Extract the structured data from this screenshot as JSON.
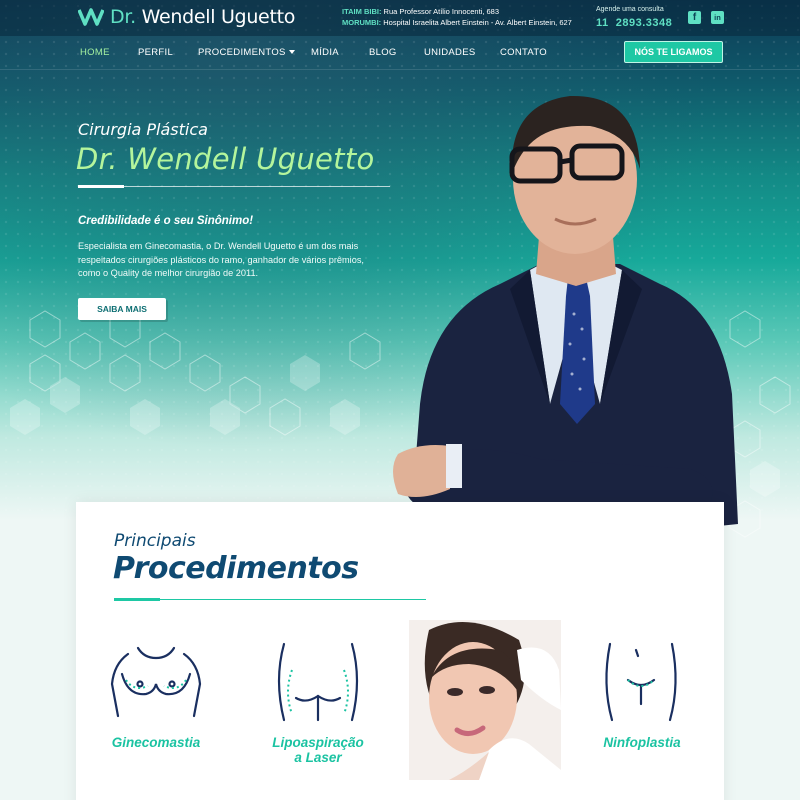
{
  "header": {
    "logo_prefix": "Dr.",
    "logo_name": "Wendell Uguetto",
    "addresses": [
      {
        "key": "ITAIM BIBI:",
        "text": "Rua Professor Atílio Innocenti, 683"
      },
      {
        "key": "MORUMBI:",
        "text": "Hospital Israelita Albert Einstein - Av. Albert Einstein, 627"
      }
    ],
    "consult_label": "Agende uma consulta",
    "phone_prefix": "11",
    "phone": "2893.3348",
    "social": [
      {
        "name": "facebook-icon",
        "glyph": "f"
      },
      {
        "name": "linkedin-icon",
        "glyph": "in"
      }
    ]
  },
  "nav": {
    "items": [
      "HOME",
      "PERFIL",
      "PROCEDIMENTOS",
      "MÍDIA",
      "BLOG",
      "UNIDADES",
      "CONTATO"
    ],
    "cta": "NÓS TE LIGAMOS"
  },
  "hero": {
    "subtitle": "Cirurgia Plástica",
    "title": "Dr. Wendell  Uguetto",
    "tagline": "Credibilidade é o seu Sinônimo!",
    "description": "Especialista em Ginecomastia, o Dr. Wendell Uguetto é um dos mais respeitados cirurgiões plásticos do ramo, ganhador de vários prêmios, como o Quality de melhor cirurgião de 2011.",
    "button": "SAIBA MAIS"
  },
  "procedures": {
    "subtitle": "Principais",
    "title": "Procedimentos",
    "items": [
      {
        "label": "Ginecomastia",
        "icon": "chest-icon"
      },
      {
        "label": "Lipoaspiração\na Laser",
        "icon": "torso-icon"
      },
      {
        "label": "",
        "icon": "face-photo"
      },
      {
        "label": "Ninfoplastia",
        "icon": "pelvis-icon"
      }
    ]
  },
  "colors": {
    "accent": "#1ec8a4",
    "brand_dark": "#0f4a72",
    "title_green": "#b4f59c"
  }
}
